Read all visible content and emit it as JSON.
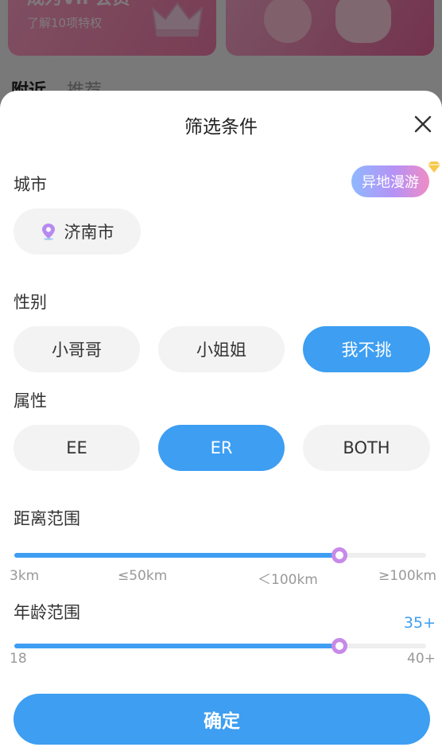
{
  "background": {
    "card_title": "成为VIP会员",
    "card_subtitle": "了解10项特权",
    "tab_active": "附近",
    "tab_other": "推荐"
  },
  "sheet": {
    "title": "筛选条件",
    "close_icon": "close-icon"
  },
  "city": {
    "label": "城市",
    "roam_label": "异地漫游",
    "current": "济南市",
    "pin_icon": "location-pin-icon"
  },
  "gender": {
    "label": "性别",
    "options": [
      "小哥哥",
      "小姐姐",
      "我不挑"
    ],
    "selected": "我不挑"
  },
  "attribute": {
    "label": "属性",
    "options": [
      "EE",
      "ER",
      "BOTH"
    ],
    "selected": "ER"
  },
  "distance": {
    "label": "距离范围",
    "ticks": [
      "3km",
      "≤50km",
      "＜100km",
      "≥100km"
    ],
    "value_fraction": 0.79
  },
  "age": {
    "label": "年龄范围",
    "value": "35+",
    "min_label": "18",
    "max_label": "40+",
    "value_fraction": 0.79
  },
  "confirm": {
    "label": "确定"
  },
  "colors": {
    "accent": "#3d9ef2",
    "thumb_border": "#c78ae8",
    "pill_bg": "#f3f3f3"
  }
}
